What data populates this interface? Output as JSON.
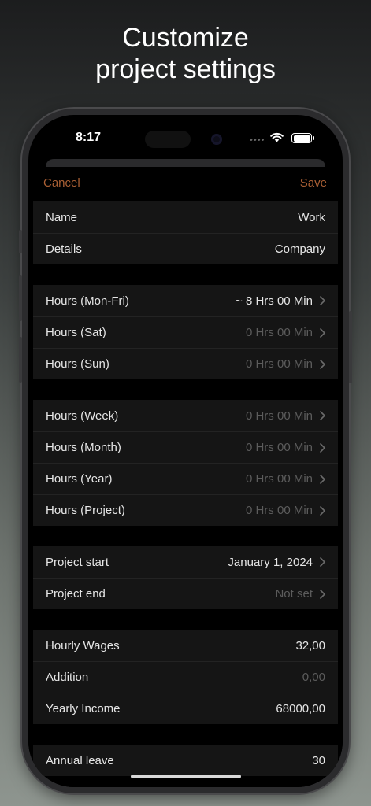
{
  "headline": {
    "line1": "Customize",
    "line2": "project settings"
  },
  "status_bar": {
    "time": "8:17",
    "dots": "••••",
    "wifi_icon": "wifi-icon",
    "battery_icon": "battery-icon"
  },
  "nav": {
    "cancel": "Cancel",
    "save": "Save",
    "accent": "#a95f34"
  },
  "basic": [
    {
      "label": "Name",
      "value": "Work"
    },
    {
      "label": "Details",
      "value": "Company"
    }
  ],
  "daily_hours": [
    {
      "label": "Hours (Mon-Fri)",
      "value": "~ 8 Hrs 00 Min"
    },
    {
      "label": "Hours (Sat)",
      "value": "0 Hrs 00 Min"
    },
    {
      "label": "Hours (Sun)",
      "value": "0 Hrs 00 Min"
    }
  ],
  "period_hours": [
    {
      "label": "Hours (Week)",
      "value": "0 Hrs 00 Min"
    },
    {
      "label": "Hours (Month)",
      "value": "0 Hrs 00 Min"
    },
    {
      "label": "Hours (Year)",
      "value": "0 Hrs 00 Min"
    },
    {
      "label": "Hours (Project)",
      "value": "0 Hrs 00 Min"
    }
  ],
  "dates": [
    {
      "label": "Project start",
      "value": "January 1, 2024"
    },
    {
      "label": "Project end",
      "value": "Not set"
    }
  ],
  "wages": [
    {
      "label": "Hourly Wages",
      "value": "32,00"
    },
    {
      "label": "Addition",
      "value": "0,00"
    },
    {
      "label": "Yearly Income",
      "value": "68000,00"
    }
  ],
  "partial": {
    "label": "Annual leave",
    "value": "30"
  },
  "colors": {
    "muted_value": "#5c5c5c",
    "cell_bg": "#151515"
  }
}
